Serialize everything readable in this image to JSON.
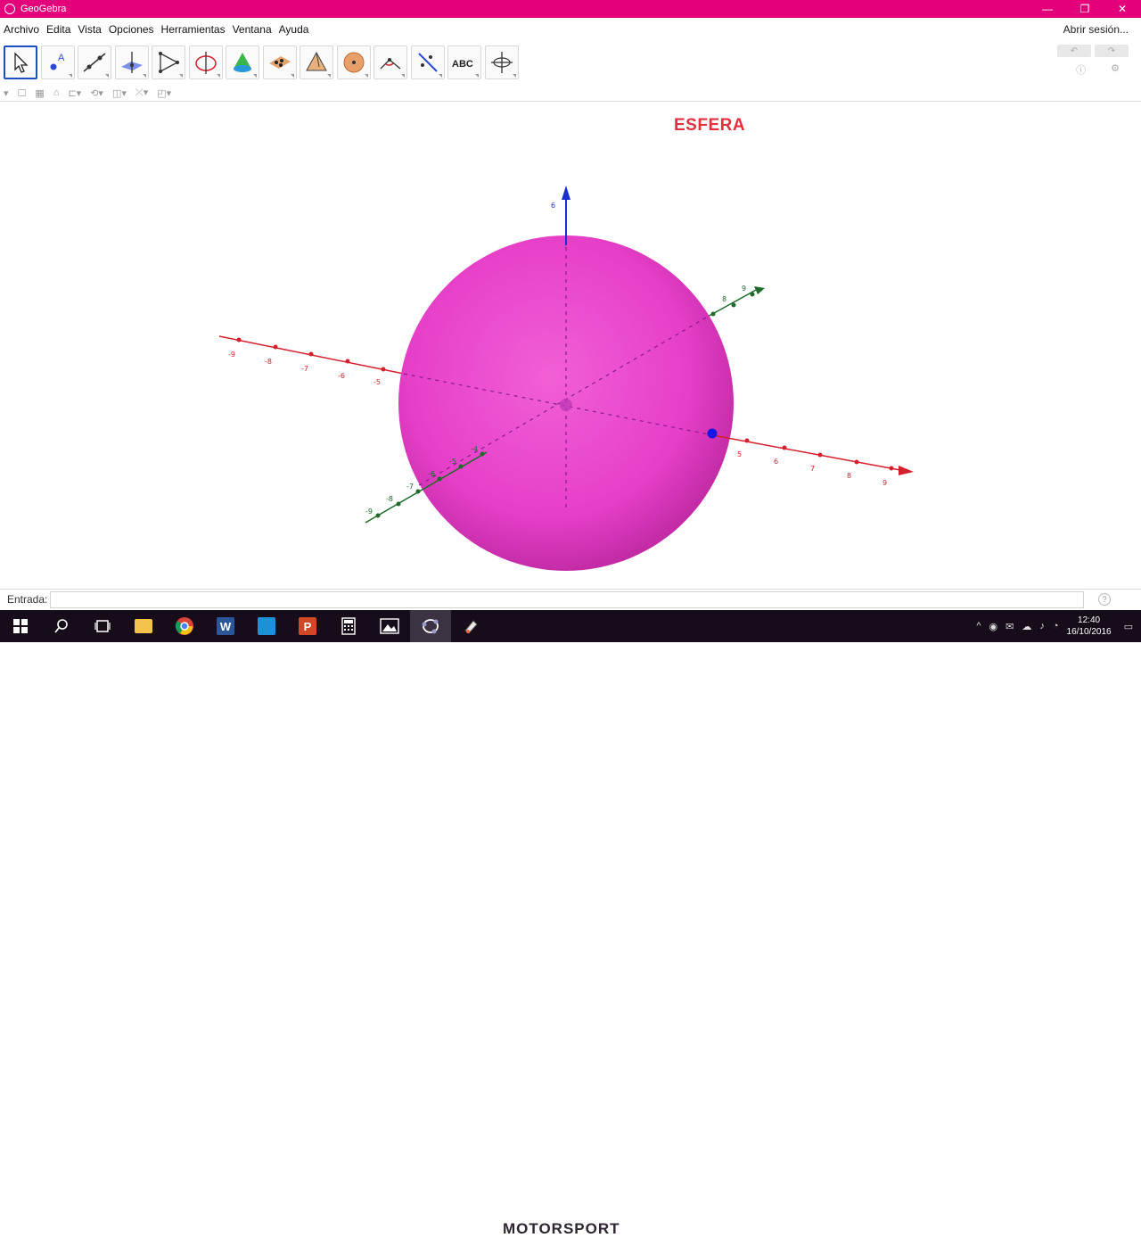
{
  "window": {
    "title": "GeoGebra",
    "controls": [
      "—",
      "❐",
      "✕"
    ]
  },
  "menu": {
    "items": [
      "Archivo",
      "Edita",
      "Vista",
      "Opciones",
      "Herramientas",
      "Ventana",
      "Ayuda"
    ],
    "signin": "Abrir sesión..."
  },
  "toolbar": {
    "tools": [
      {
        "name": "move-tool",
        "icon": "arrow-cursor-icon",
        "active": true
      },
      {
        "name": "point-tool",
        "icon": "point-a-icon"
      },
      {
        "name": "line-tool",
        "icon": "line-icon"
      },
      {
        "name": "plane-perpendicular-tool",
        "icon": "perpendicular-icon"
      },
      {
        "name": "polygon-tool",
        "icon": "triangle-icon"
      },
      {
        "name": "circle-axis-tool",
        "icon": "circle-axis-icon"
      },
      {
        "name": "intersect-surfaces-tool",
        "icon": "cone-icon"
      },
      {
        "name": "plane-three-points-tool",
        "icon": "plane-points-icon"
      },
      {
        "name": "pyramid-tool",
        "icon": "pyramid-icon"
      },
      {
        "name": "sphere-tool",
        "icon": "sphere-icon"
      },
      {
        "name": "angle-tool",
        "icon": "angle-icon"
      },
      {
        "name": "reflect-tool",
        "icon": "reflect-icon"
      },
      {
        "name": "text-tool",
        "icon": "text-abc-icon",
        "label": "ABC"
      },
      {
        "name": "rotate-view-tool",
        "icon": "rotate-view-icon"
      }
    ],
    "tool_labels": {
      "text": "ABC"
    }
  },
  "graphics": {
    "heading": "ESFERA",
    "sphere_color": "#e63fc8",
    "axes": {
      "x": {
        "color": "#d61f2c",
        "labels_neg": [
          "-9",
          "-8",
          "-7",
          "-6",
          "-5"
        ],
        "labels_pos": [
          "5",
          "6",
          "7",
          "8",
          "9"
        ]
      },
      "y": {
        "color": "#1e6b2a",
        "labels_neg": [
          "-9",
          "-8",
          "-7",
          "-6",
          "-5",
          "-4"
        ],
        "labels_pos": [
          "8",
          "9"
        ]
      },
      "z": {
        "color": "#1a2fd0",
        "label": "6"
      }
    },
    "point_color": "#1616e6"
  },
  "inputbar": {
    "label": "Entrada:",
    "help": "?"
  },
  "taskbar": {
    "clock_time": "12:40",
    "clock_date": "16/10/2016",
    "apps": [
      "start",
      "search",
      "task-view",
      "file-explorer",
      "chrome",
      "word",
      "store",
      "powerpoint",
      "calculator",
      "photos",
      "geogebra",
      "paint"
    ],
    "watermark": "MOTORSPORT"
  }
}
